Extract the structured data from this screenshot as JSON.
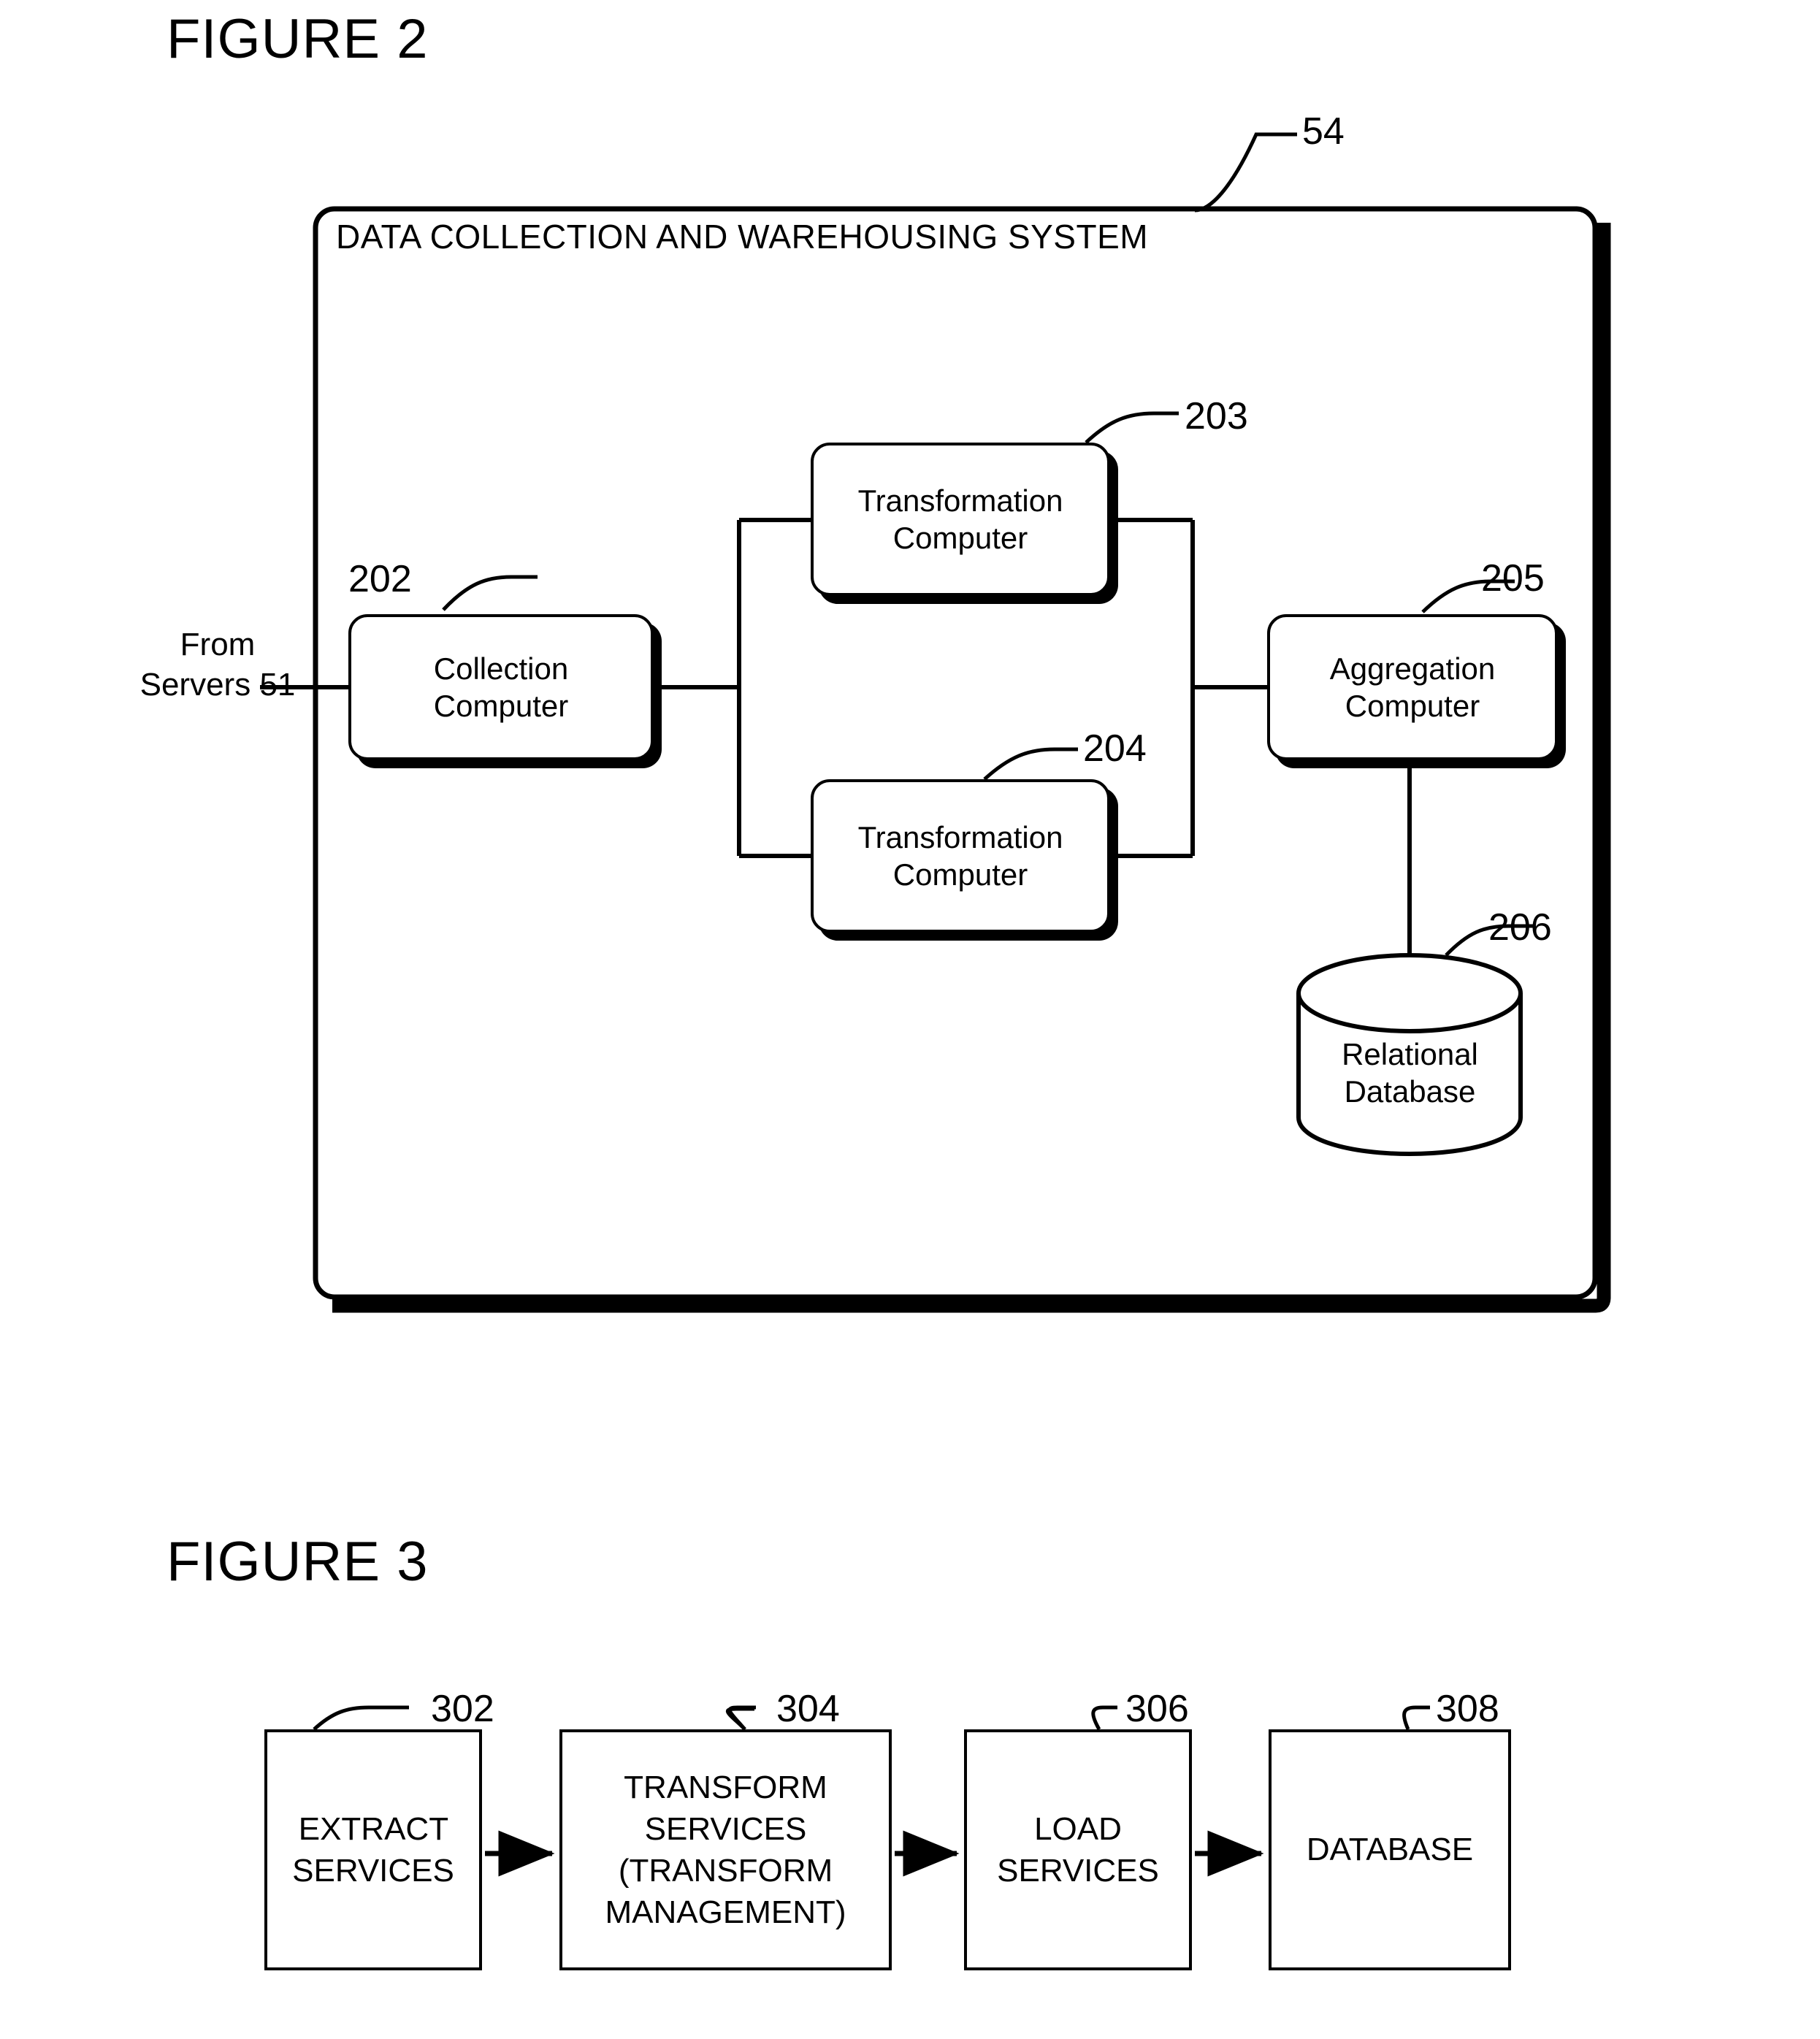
{
  "figure2": {
    "title": "FIGURE 2",
    "system_box": {
      "label": "DATA COLLECTION AND WAREHOUSING SYSTEM",
      "ref": "54"
    },
    "external_input": {
      "line1": "From",
      "line2": "Servers",
      "line3": "51"
    },
    "nodes": [
      {
        "ref": "202",
        "line1": "Collection",
        "line2": "Computer"
      },
      {
        "ref": "203",
        "line1": "Transformation",
        "line2": "Computer"
      },
      {
        "ref": "204",
        "line1": "Transformation",
        "line2": "Computer"
      },
      {
        "ref": "205",
        "line1": "Aggregation",
        "line2": "Computer"
      },
      {
        "ref": "206",
        "line1": "Relational",
        "line2": "Database"
      }
    ]
  },
  "figure3": {
    "title": "FIGURE 3",
    "boxes": [
      {
        "ref": "302",
        "line1": "EXTRACT",
        "line2": "SERVICES",
        "line3": "",
        "line4": ""
      },
      {
        "ref": "304",
        "line1": "TRANSFORM",
        "line2": "SERVICES",
        "line3": "(TRANSFORM",
        "line4": "MANAGEMENT)"
      },
      {
        "ref": "306",
        "line1": "LOAD",
        "line2": "SERVICES",
        "line3": "",
        "line4": ""
      },
      {
        "ref": "308",
        "line1": "DATABASE",
        "line2": "",
        "line3": "",
        "line4": ""
      }
    ]
  },
  "colors": {
    "ink": "#000000",
    "paper": "#ffffff"
  }
}
